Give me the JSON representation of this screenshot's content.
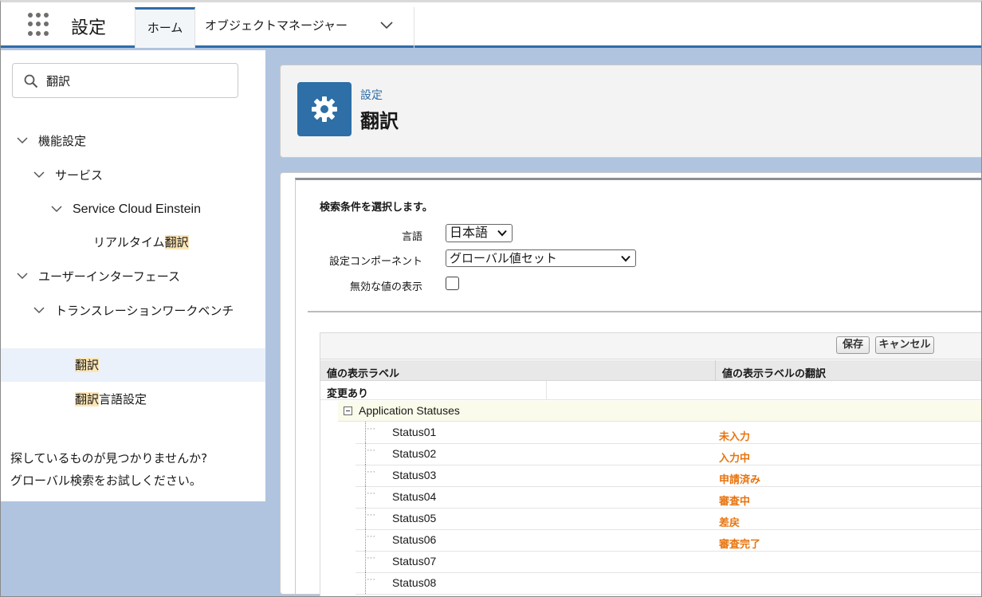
{
  "header": {
    "app_title": "設定",
    "tabs": [
      {
        "label": "ホーム"
      },
      {
        "label": "オブジェクトマネージャー"
      }
    ]
  },
  "sidebar": {
    "search_value": "翻訳",
    "tree": [
      {
        "label": "機能設定"
      },
      {
        "label": "サービス"
      },
      {
        "label": "Service Cloud Einstein"
      },
      {
        "label_pre": "リアルタイム",
        "label_hl": "翻訳",
        "label_post": ""
      },
      {
        "label": "ユーザーインターフェース"
      },
      {
        "label": "トランスレーションワークベンチ"
      },
      {
        "label_pre": "",
        "label_hl": "翻訳",
        "label_post": ""
      },
      {
        "label_pre": "",
        "label_hl": "翻訳",
        "label_post": "言語設定"
      }
    ],
    "no_find_line1": "探しているものが見つかりませんか?",
    "no_find_line2": "グローバル検索をお試しください。"
  },
  "page_header": {
    "breadcrumb": "設定",
    "title": "翻訳"
  },
  "form": {
    "criteria_title": "検索条件を選択します。",
    "language_label": "言語",
    "language_value": "日本語",
    "component_label": "設定コンポーネント",
    "component_value": "グローバル値セット",
    "inactive_label": "無効な値の表示",
    "inactive_checked": false
  },
  "grid": {
    "save_label": "保存",
    "cancel_label": "キャンセル",
    "col1": "値の表示ラベル",
    "col2": "値の表示ラベルの翻訳",
    "changed_label": "変更あり",
    "group_label": "Application Statuses",
    "rows": [
      {
        "name": "Status01",
        "translation": "未入力"
      },
      {
        "name": "Status02",
        "translation": "入力中"
      },
      {
        "name": "Status03",
        "translation": "申請済み"
      },
      {
        "name": "Status04",
        "translation": "審査中"
      },
      {
        "name": "Status05",
        "translation": "差戻"
      },
      {
        "name": "Status06",
        "translation": "審査完了"
      },
      {
        "name": "Status07",
        "translation": ""
      },
      {
        "name": "Status08",
        "translation": ""
      }
    ]
  },
  "colors": {
    "brand_blue": "#2e6ca8",
    "highlight": "#fde6b6",
    "translation_orange": "#e8730c"
  }
}
